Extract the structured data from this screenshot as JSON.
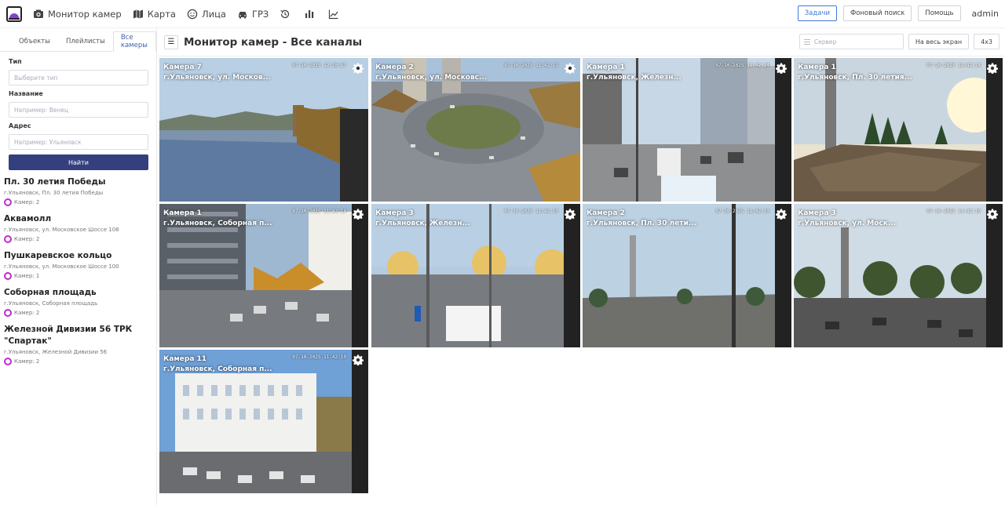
{
  "nav": {
    "items": [
      {
        "label": "Монитор камер",
        "icon": "camera-icon"
      },
      {
        "label": "Карта",
        "icon": "map-icon"
      },
      {
        "label": "Лица",
        "icon": "face-icon"
      },
      {
        "label": "ГРЗ",
        "icon": "car-icon"
      }
    ],
    "icon_items": [
      "history-icon",
      "bar-chart-icon",
      "line-chart-icon"
    ],
    "buttons": {
      "tasks": "Задачи",
      "background_search": "Фоновый поиск",
      "help": "Помощь"
    },
    "user": "admin"
  },
  "sidebar": {
    "tabs": [
      "Объекты",
      "Плейлисты",
      "Все камеры"
    ],
    "active_tab": 2,
    "form": {
      "type_label": "Тип",
      "type_placeholder": "Выберите тип",
      "name_label": "Название",
      "name_placeholder": "Например: Венец",
      "address_label": "Адрес",
      "address_placeholder": "Например: Ульяновск",
      "find_button": "Найти"
    },
    "objects": [
      {
        "title": "Пл. 30 летия Победы",
        "address": "г.Ульяновск, Пл. 30 летия Победы",
        "cameras": "Камер: 2"
      },
      {
        "title": "Аквамолл",
        "address": "г.Ульяновск, ул. Московское Шоссе 108",
        "cameras": "Камер: 2"
      },
      {
        "title": "Пушкаревское кольцо",
        "address": "г.Ульяновск, ул. Московское Шоссе 100",
        "cameras": "Камер: 1"
      },
      {
        "title": "Соборная площадь",
        "address": "г.Ульяновск, Соборная площадь",
        "cameras": "Камер: 2"
      },
      {
        "title": "Железной Дивизии 56 ТРК \"Спартак\"",
        "address": "г.Ульяновск, Железной Дивизии 56",
        "cameras": "Камер: 2"
      }
    ]
  },
  "main": {
    "menu_icon": "hamburger-icon",
    "title": "Монитор камер - Все каналы",
    "server_placeholder": "Сервер",
    "fullscreen": "На весь экран",
    "layout": "4x3"
  },
  "cameras": [
    {
      "name": "Камера 7",
      "address": "г.Ульяновск, ул. Москов...",
      "stamp": "07-10-2025 12:10:57",
      "scene": "river"
    },
    {
      "name": "Камера 2",
      "address": "г.Ульяновск, ул. Московс...",
      "stamp": "07-10-2025 11:42:17",
      "scene": "roundabout"
    },
    {
      "name": "Камера 1",
      "address": "г.Ульяновск, Железн...",
      "stamp": "07-10-2025 11:42:14",
      "scene": "street"
    },
    {
      "name": "Камера 1",
      "address": "г.Ульяновск, Пл. 30 летия...",
      "stamp": "07-10-2025 11:42:14",
      "scene": "monument"
    },
    {
      "name": "Камера 1",
      "address": "г.Ульяновск, Соборная п...",
      "stamp": "07-10-2025 11:42:14",
      "scene": "parking"
    },
    {
      "name": "Камера 3",
      "address": "г.Ульяновск, Железн...",
      "stamp": "07-10-2025 11:42:10",
      "scene": "road"
    },
    {
      "name": "Камера 2",
      "address": "г.Ульяновск, Пл. 30 лети...",
      "stamp": "07-10-2025 11:42:10",
      "scene": "square"
    },
    {
      "name": "Камера 3",
      "address": "г.Ульяновск, ул. Моск...",
      "stamp": "07-10-2025 11:42:10",
      "scene": "park"
    },
    {
      "name": "Камера 11",
      "address": "г.Ульяновск, Соборная п...",
      "stamp": "07-10-2025 11:42:10",
      "scene": "building"
    }
  ],
  "colors": {
    "accent": "#3f7ad6",
    "find_button": "#34407e",
    "camera_ring": "#c02bd0",
    "active_tab": "#3f5fae"
  }
}
